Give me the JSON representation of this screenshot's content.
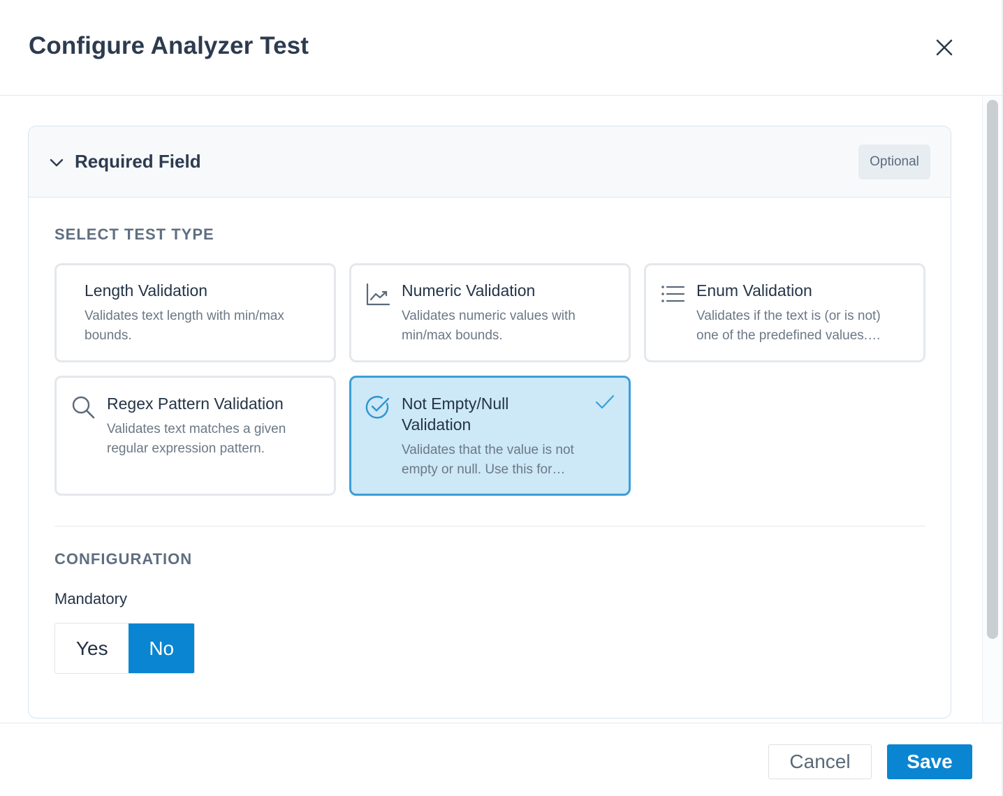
{
  "dialog": {
    "title": "Configure Analyzer Test"
  },
  "section": {
    "title": "Required Field",
    "badge": "Optional"
  },
  "test_type": {
    "heading": "SELECT TEST TYPE",
    "options": [
      {
        "title": "Length Validation",
        "description": "Validates text length with min/max bounds.",
        "icon": "none",
        "selected": false
      },
      {
        "title": "Numeric Validation",
        "description": "Validates numeric values with min/max bounds.",
        "icon": "line-chart-icon",
        "selected": false
      },
      {
        "title": "Enum Validation",
        "description": "Validates if the text is (or is not) one of the predefined values.…",
        "icon": "list-icon",
        "selected": false
      },
      {
        "title": "Regex Pattern Validation",
        "description": "Validates text matches a given regular expression pattern.",
        "icon": "search-icon",
        "selected": false
      },
      {
        "title": "Not Empty/Null Validation",
        "description": "Validates that the value is not empty or null. Use this for…",
        "icon": "check-circle-icon",
        "selected": true
      }
    ]
  },
  "configuration": {
    "heading": "CONFIGURATION",
    "mandatory_label": "Mandatory",
    "yes_label": "Yes",
    "no_label": "No",
    "selected": "No"
  },
  "footer": {
    "cancel_label": "Cancel",
    "save_label": "Save"
  },
  "colors": {
    "accent": "#0a85d1",
    "selected_card_bg": "#cde8f7",
    "selected_card_border": "#3b9fd8"
  }
}
